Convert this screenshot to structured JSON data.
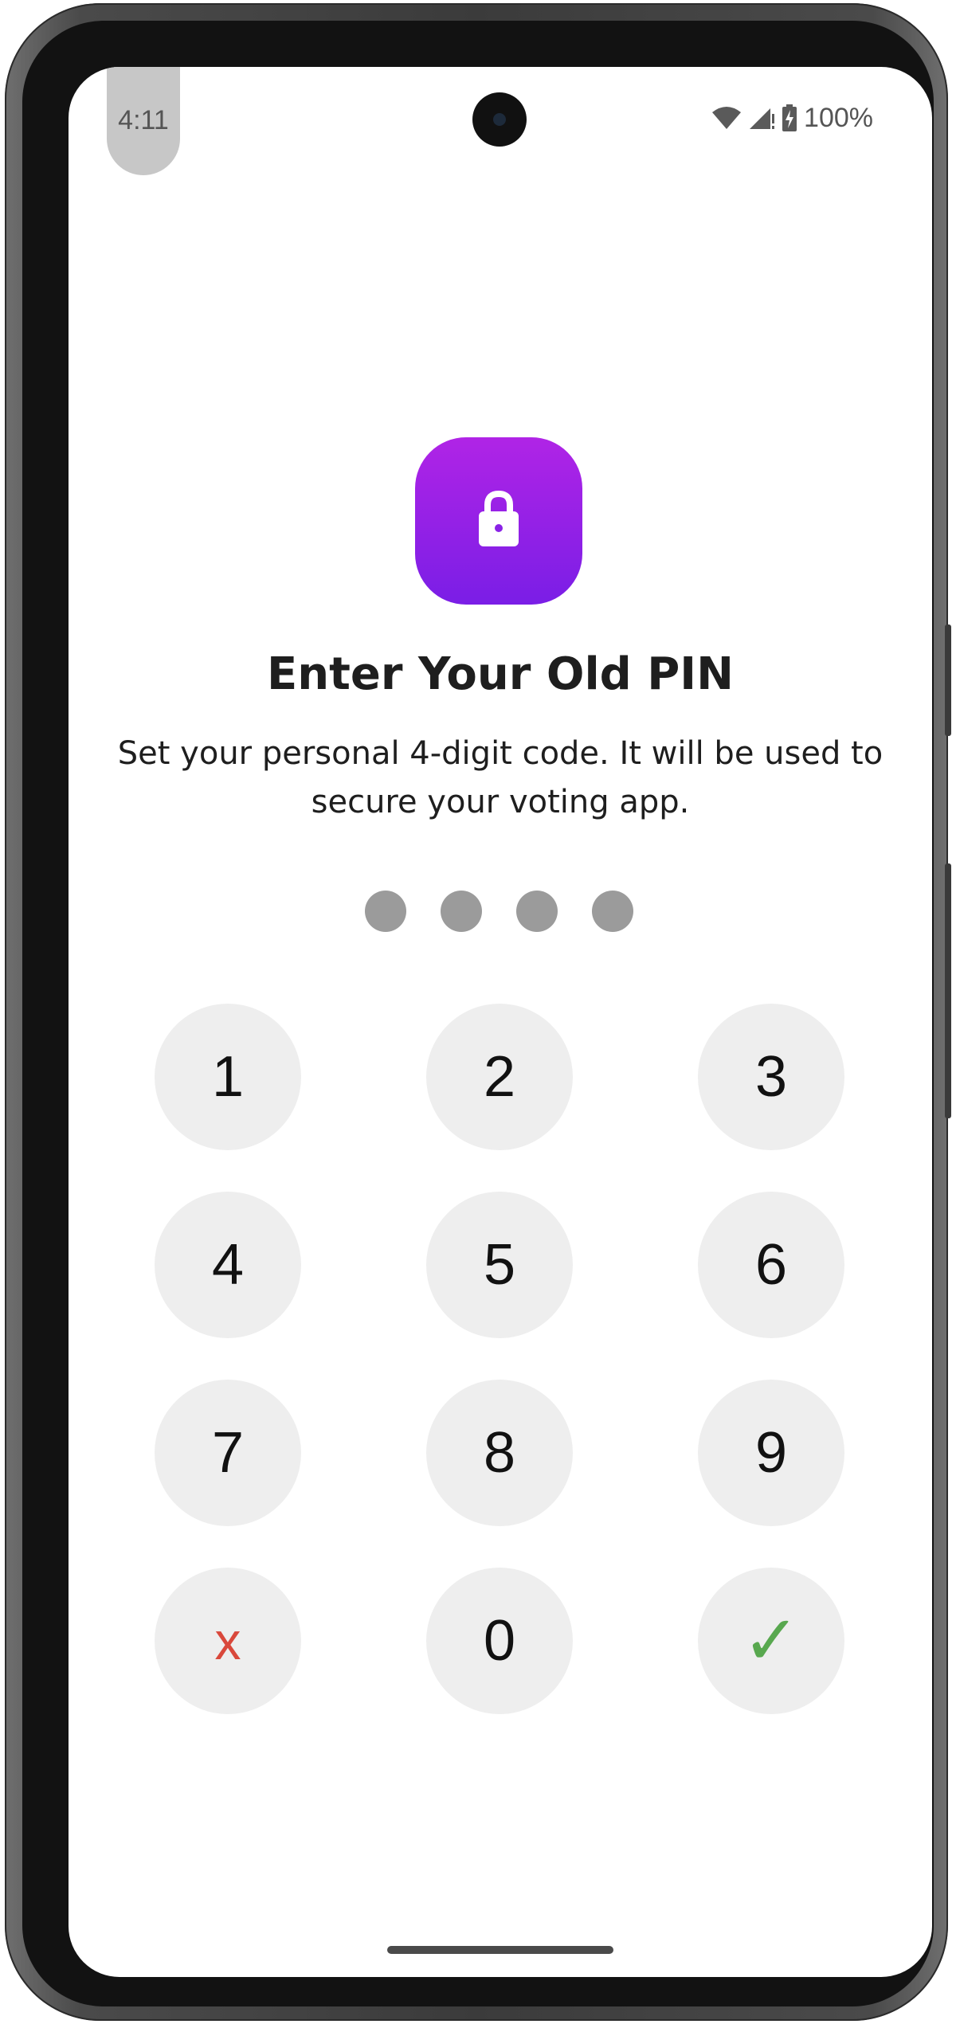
{
  "status_bar": {
    "time": "4:11",
    "battery": "100%",
    "icons": [
      "wifi-icon",
      "cellular-signal-icon",
      "battery-charging-icon"
    ]
  },
  "header": {
    "icon": "lock-icon",
    "title": "Enter Your Old PIN",
    "subtitle": "Set your personal 4-digit code. It will be used to secure your voting app."
  },
  "pin": {
    "length": 4,
    "entered": 0
  },
  "keypad": {
    "keys": [
      {
        "label": "1"
      },
      {
        "label": "2"
      },
      {
        "label": "3"
      },
      {
        "label": "4"
      },
      {
        "label": "5"
      },
      {
        "label": "6"
      },
      {
        "label": "7"
      },
      {
        "label": "8"
      },
      {
        "label": "9"
      },
      {
        "label": "x"
      },
      {
        "label": "0"
      },
      {
        "label": "✓"
      }
    ]
  },
  "colors": {
    "accent_top": "#b024e6",
    "accent_bottom": "#7a1ee6",
    "clear_key": "#d9483b",
    "confirm_key": "#58a84f",
    "key_bg": "#eeeeee",
    "pin_dot": "#9b9b9b"
  }
}
